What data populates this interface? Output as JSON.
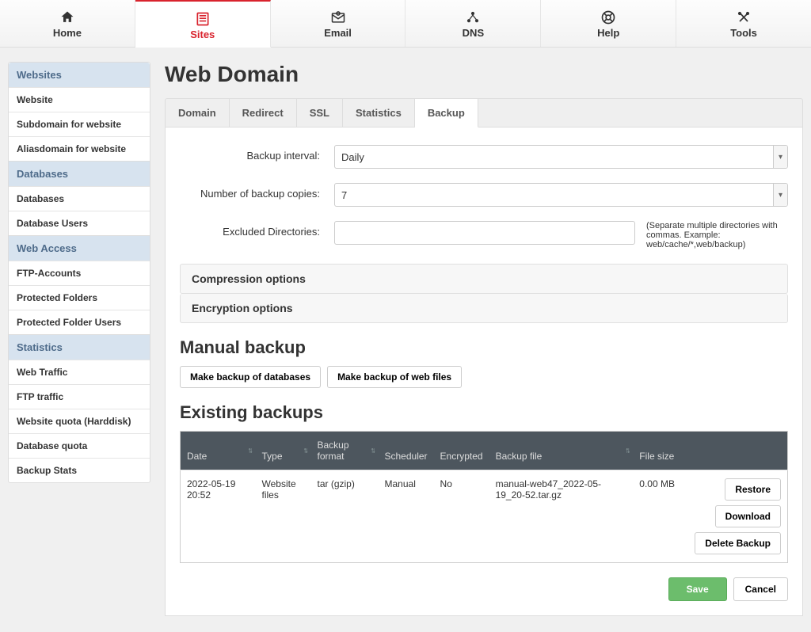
{
  "topnav": [
    {
      "label": "Home"
    },
    {
      "label": "Sites"
    },
    {
      "label": "Email"
    },
    {
      "label": "DNS"
    },
    {
      "label": "Help"
    },
    {
      "label": "Tools"
    }
  ],
  "sidebar": {
    "groups": [
      {
        "header": "Websites",
        "items": [
          "Website",
          "Subdomain for website",
          "Aliasdomain for website"
        ]
      },
      {
        "header": "Databases",
        "items": [
          "Databases",
          "Database Users"
        ]
      },
      {
        "header": "Web Access",
        "items": [
          "FTP-Accounts",
          "Protected Folders",
          "Protected Folder Users"
        ]
      },
      {
        "header": "Statistics",
        "items": [
          "Web Traffic",
          "FTP traffic",
          "Website quota (Harddisk)",
          "Database quota",
          "Backup Stats"
        ]
      }
    ]
  },
  "page": {
    "title": "Web Domain"
  },
  "tabs": [
    "Domain",
    "Redirect",
    "SSL",
    "Statistics",
    "Backup"
  ],
  "form": {
    "backup_interval": {
      "label": "Backup interval:",
      "value": "Daily"
    },
    "copies": {
      "label": "Number of backup copies:",
      "value": "7"
    },
    "excluded": {
      "label": "Excluded Directories:",
      "hint": "(Separate multiple directories with commas. Example: web/cache/*,web/backup)"
    },
    "panels": [
      "Compression options",
      "Encryption options"
    ]
  },
  "manual": {
    "title": "Manual backup",
    "btn_db": "Make backup of databases",
    "btn_web": "Make backup of web files"
  },
  "existing": {
    "title": "Existing backups",
    "headers": [
      "Date",
      "Type",
      "Backup format",
      "Scheduler",
      "Encrypted",
      "Backup file",
      "File size",
      ""
    ],
    "rows": [
      {
        "date": "2022-05-19 20:52",
        "type": "Website files",
        "format": "tar (gzip)",
        "scheduler": "Manual",
        "encrypted": "No",
        "file": "manual-web47_2022-05-19_20-52.tar.gz",
        "size": "0.00 MB"
      }
    ],
    "actions": {
      "restore": "Restore",
      "download": "Download",
      "delete": "Delete Backup"
    }
  },
  "footer": {
    "save": "Save",
    "cancel": "Cancel"
  }
}
